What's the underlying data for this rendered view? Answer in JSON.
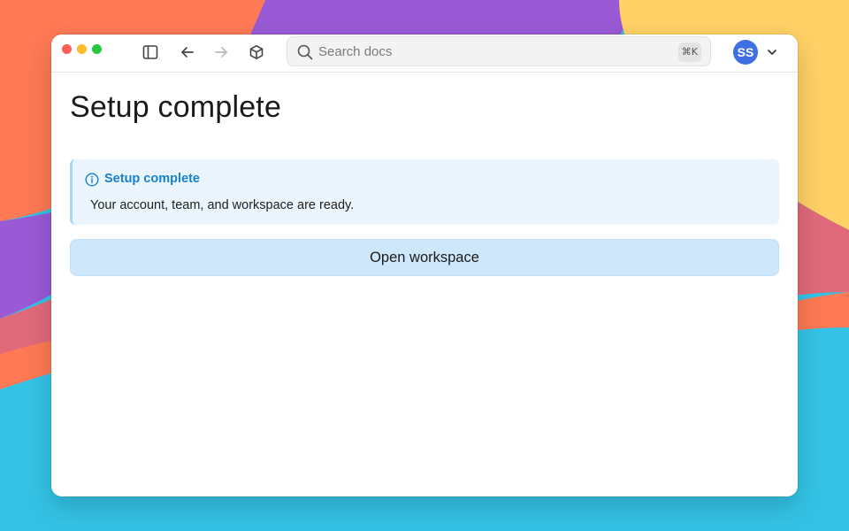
{
  "toolbar": {
    "sidebar_icon": "sidebar-icon",
    "back_icon": "arrow-left-icon",
    "forward_icon": "arrow-right-icon",
    "forward_enabled": false,
    "box_icon": "cube-icon"
  },
  "search": {
    "placeholder": "Search docs",
    "value": "",
    "shortcut": "⌘K"
  },
  "account": {
    "avatar_initials": "SS",
    "avatar_color": "#3f6fe0",
    "menu_icon": "chevron-down-icon"
  },
  "page": {
    "title": "Setup complete"
  },
  "alert": {
    "icon": "info-icon",
    "title": "Setup complete",
    "message": "Your account, team, and workspace are ready.",
    "accent_color": "#1881c9",
    "background_color": "#eaf5fd"
  },
  "actions": {
    "primary_label": "Open workspace",
    "primary_color": "#cfe7fa"
  },
  "colors": {
    "traffic_close": "#ff5f57",
    "traffic_minimize": "#febc2e",
    "traffic_zoom": "#28c840"
  }
}
